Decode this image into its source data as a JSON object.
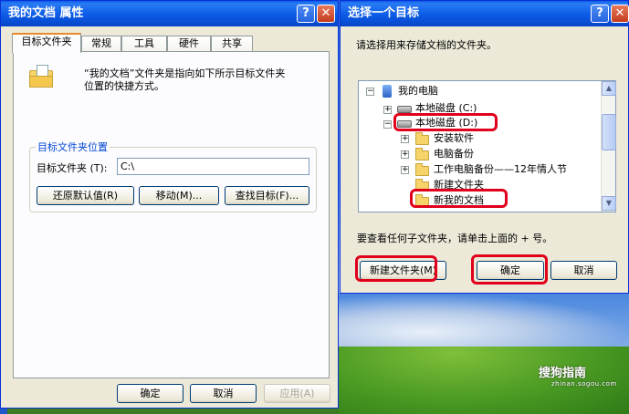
{
  "properties": {
    "title": "我的文档 属性",
    "title_help": "?",
    "title_close": "✕",
    "tabs": [
      "目标文件夹",
      "常规",
      "工具",
      "硬件",
      "共享"
    ],
    "description_line1": "“我的文档”文件夹是指向如下所示目标文件夹",
    "description_line2": "位置的快捷方式。",
    "group_label": "目标文件夹位置",
    "target_label": "目标文件夹 (T):",
    "target_value": "C:\\",
    "restore_button": "还原默认值(R)",
    "move_button": "移动(M)...",
    "find_button": "查找目标(F)...",
    "ok_button": "确定",
    "cancel_button": "取消",
    "apply_button": "应用(A)"
  },
  "browse": {
    "title": "选择一个目标",
    "title_help": "?",
    "title_close": "✕",
    "instruction": "请选择用来存储文档的文件夹。",
    "tree": [
      {
        "label": "我的电脑",
        "expander": "−",
        "icon": "computer-icon"
      },
      {
        "label": "本地磁盘 (C:)",
        "expander": "+",
        "icon": "disk-icon"
      },
      {
        "label": "本地磁盘 (D:)",
        "expander": "−",
        "icon": "disk-icon"
      },
      {
        "label": "安装软件",
        "expander": "+",
        "icon": "folder-icon"
      },
      {
        "label": "电脑备份",
        "expander": "+",
        "icon": "folder-icon"
      },
      {
        "label": "工作电脑备份——12年情人节",
        "expander": "+",
        "icon": "folder-icon"
      },
      {
        "label": "新建文件夹",
        "expander": "",
        "icon": "folder-icon"
      },
      {
        "label": "新我的文档",
        "expander": "",
        "icon": "folder-icon"
      }
    ],
    "hint": "要查看任何子文件夹，请单击上面的 + 号。",
    "new_folder_button": "新建文件夹(M)",
    "ok_button": "确定",
    "cancel_button": "取消"
  },
  "watermark": {
    "brand": "搜狗指南",
    "url": "zhinan.sogou.com"
  },
  "colors": {
    "highlight": "#e0001b",
    "titlebar": "#0a5ee8",
    "group_label": "#0046d5"
  }
}
